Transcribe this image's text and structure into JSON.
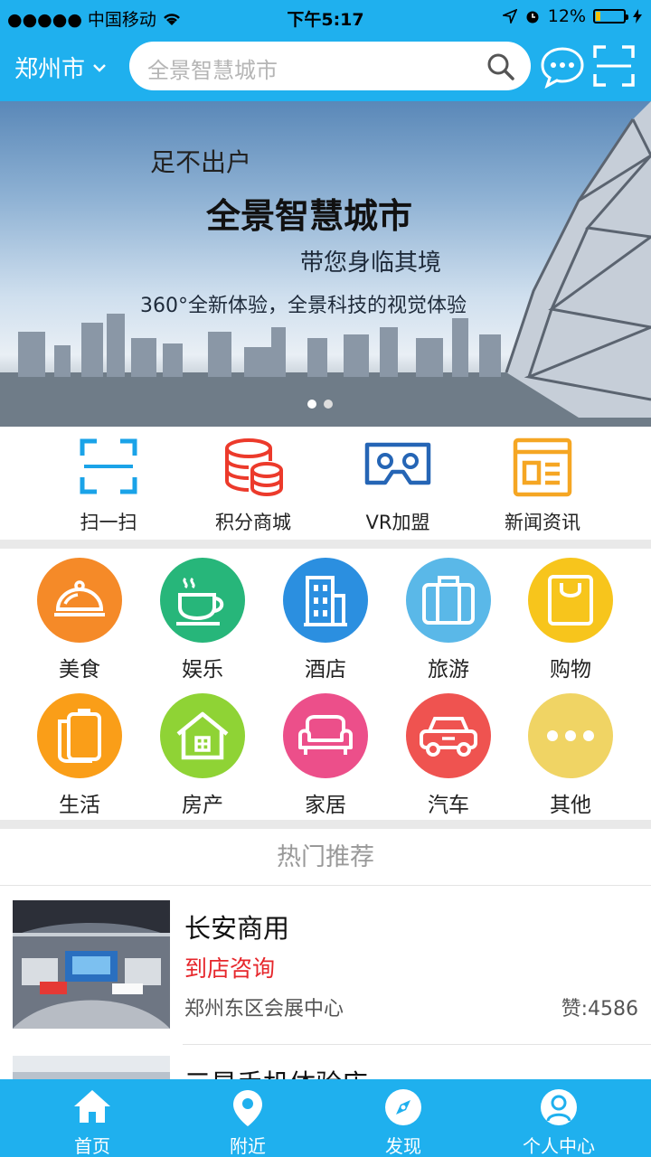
{
  "status_bar": {
    "carrier": "●●●●● 中国移动",
    "time": "下午5:17",
    "battery": "12%"
  },
  "header": {
    "city": "郑州市",
    "search_placeholder": "全景智慧城市"
  },
  "banner": {
    "line1": "足不出户",
    "line2": "全景智慧城市",
    "line3": "带您身临其境",
    "line4": "360°全新体验，全景科技的视觉体验"
  },
  "quick_actions": [
    {
      "label": "扫一扫",
      "icon": "scan-icon",
      "color": "#1aa3e8"
    },
    {
      "label": "积分商城",
      "icon": "coins-icon",
      "color": "#ec3a2b"
    },
    {
      "label": "VR加盟",
      "icon": "vr-headset-icon",
      "color": "#2565b5"
    },
    {
      "label": "新闻资讯",
      "icon": "news-icon",
      "color": "#f5a623"
    }
  ],
  "categories": [
    {
      "label": "美食",
      "icon": "food-cloche-icon",
      "color": "#f58a28"
    },
    {
      "label": "娱乐",
      "icon": "coffee-cup-icon",
      "color": "#27b67a"
    },
    {
      "label": "酒店",
      "icon": "hotel-building-icon",
      "color": "#2b8fe0"
    },
    {
      "label": "旅游",
      "icon": "suitcase-icon",
      "color": "#5ab8e8"
    },
    {
      "label": "购物",
      "icon": "shopping-bag-icon",
      "color": "#f7c51c"
    },
    {
      "label": "生活",
      "icon": "life-icon",
      "color": "#fa9e18"
    },
    {
      "label": "房产",
      "icon": "house-icon",
      "color": "#8fd335"
    },
    {
      "label": "家居",
      "icon": "sofa-icon",
      "color": "#ec4f8a"
    },
    {
      "label": "汽车",
      "icon": "car-icon",
      "color": "#ef5350"
    },
    {
      "label": "其他",
      "icon": "more-icon",
      "color": "#f0d464"
    }
  ],
  "hot": {
    "title": "热门推荐",
    "items": [
      {
        "name": "长安商用",
        "tag": "到店咨询",
        "address": "郑州东区会展中心",
        "likes": "赞:4586"
      },
      {
        "name": "三星手机体验店",
        "tag": "",
        "address": "",
        "likes": ""
      }
    ]
  },
  "tabs": [
    {
      "label": "首页",
      "icon": "home-icon"
    },
    {
      "label": "附近",
      "icon": "location-pin-icon"
    },
    {
      "label": "发现",
      "icon": "compass-icon"
    },
    {
      "label": "个人中心",
      "icon": "user-icon"
    }
  ],
  "colors": {
    "primary": "#1fb0ee",
    "accent_red": "#e6262b",
    "divider": "#e9e9e9"
  }
}
